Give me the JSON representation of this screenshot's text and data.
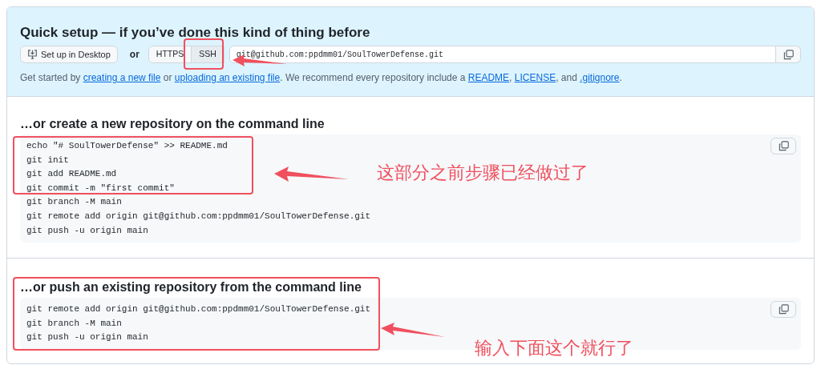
{
  "quick_setup": {
    "title": "Quick setup — if you’ve done this kind of thing before",
    "desktop_button": "Set up in Desktop",
    "or": "or",
    "protocols": [
      {
        "label": "HTTPS",
        "selected": false
      },
      {
        "label": "SSH",
        "selected": true
      }
    ],
    "clone_url": "git@github.com:ppdmm01/SoulTowerDefense.git",
    "hint": [
      {
        "text": "Get started by "
      },
      {
        "text": "creating a new file",
        "link": true
      },
      {
        "text": " or "
      },
      {
        "text": "uploading an existing file",
        "link": true
      },
      {
        "text": ". We recommend every repository include a "
      },
      {
        "text": "README",
        "link": true
      },
      {
        "text": ", "
      },
      {
        "text": "LICENSE",
        "link": true
      },
      {
        "text": ", and "
      },
      {
        "text": ".gitignore",
        "link": true
      },
      {
        "text": "."
      }
    ]
  },
  "sections": [
    {
      "title": "…or create a new repository on the command line",
      "lines": [
        "echo \"# SoulTowerDefense\" >> README.md",
        "git init",
        "git add README.md",
        "git commit -m \"first commit\"",
        "git branch -M main",
        "git remote add origin git@github.com:ppdmm01/SoulTowerDefense.git",
        "git push -u origin main"
      ]
    },
    {
      "title": "…or push an existing repository from the command line",
      "lines": [
        "git remote add origin git@github.com:ppdmm01/SoulTowerDefense.git",
        "git branch -M main",
        "git push -u origin main"
      ]
    }
  ],
  "annotations": [
    {
      "text": "这部分之前步骤已经做过了"
    },
    {
      "text": "输入下面这个就行了"
    }
  ]
}
